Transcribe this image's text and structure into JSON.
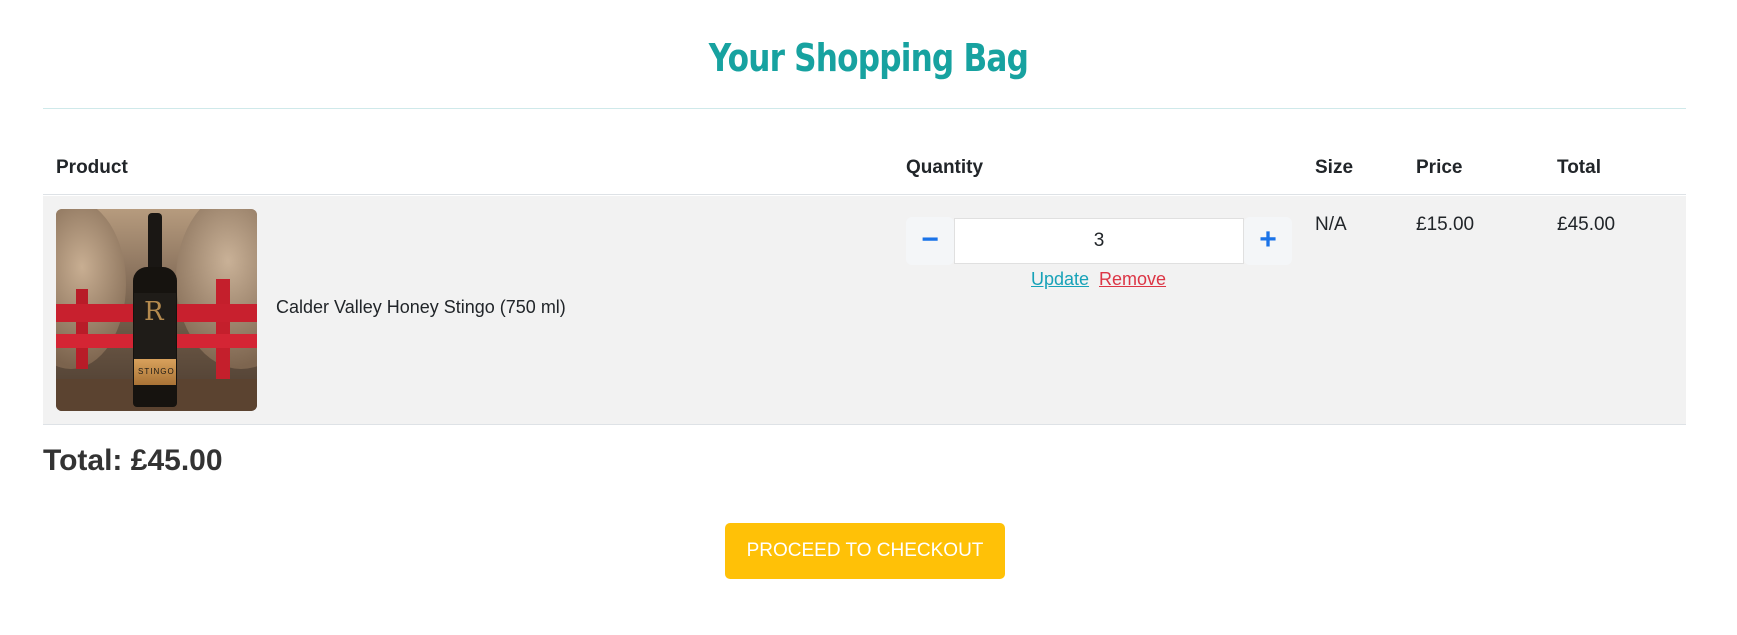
{
  "page": {
    "title": "Your Shopping Bag"
  },
  "table": {
    "headers": {
      "product": "Product",
      "quantity": "Quantity",
      "size": "Size",
      "price": "Price",
      "total": "Total"
    },
    "rows": [
      {
        "product_name": "Calder Valley Honey Stingo (750 ml)",
        "image_icon": "beer-bottle-photo",
        "image_label": "STINGO",
        "quantity": "3",
        "decrement_symbol": "−",
        "increment_symbol": "+",
        "update_label": "Update",
        "remove_label": "Remove",
        "size": "N/A",
        "price": "£15.00",
        "total": "£45.00"
      }
    ]
  },
  "summary": {
    "total_label": "Total: £45.00"
  },
  "checkout": {
    "button_label": "PROCEED TO CHECKOUT"
  },
  "colors": {
    "title": "#17a2a0",
    "update_link": "#17a2b8",
    "remove_link": "#dc3545",
    "stepper_icon": "#1a73e8",
    "checkout_button": "#ffc107",
    "row_background": "#f2f2f2"
  }
}
